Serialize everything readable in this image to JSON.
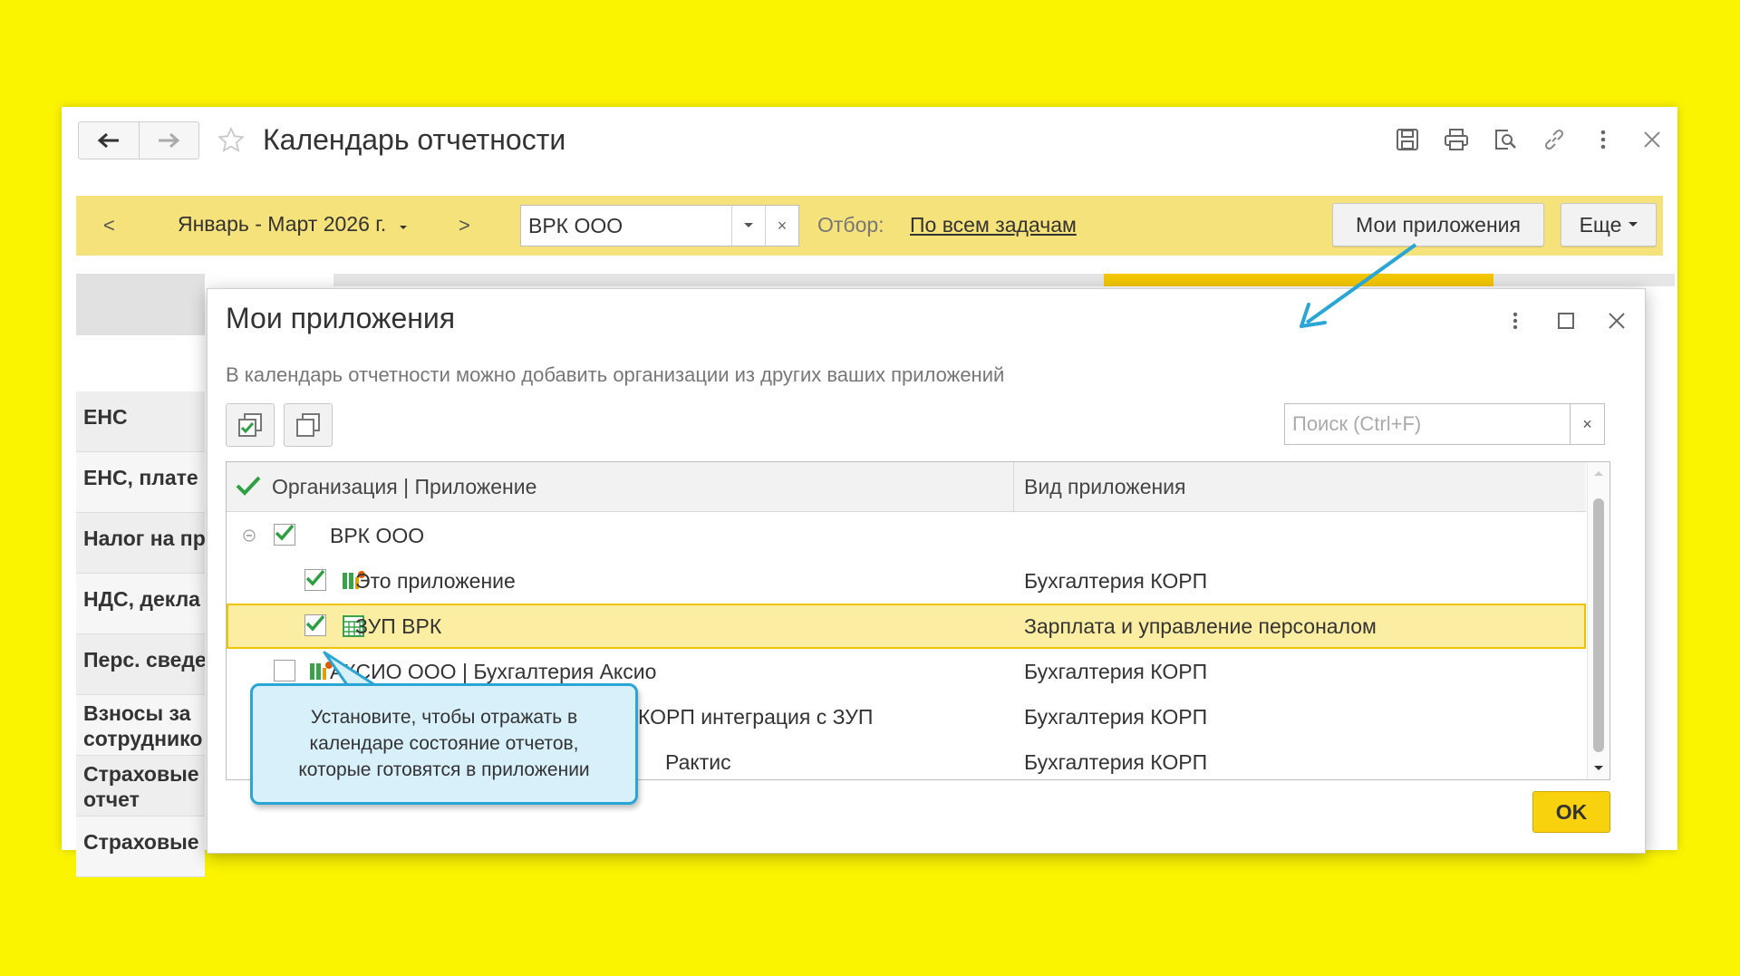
{
  "window": {
    "title": "Календарь отчетности"
  },
  "filter": {
    "prev": "<",
    "period": "Январь - Март 2026 г.",
    "next": ">",
    "organization": "ВРК ООО",
    "clear": "×",
    "otbor_label": "Отбор:",
    "otbor_value": "По всем задачам",
    "my_apps_label": "Мои приложения",
    "more_label": "Еще"
  },
  "background_rows": [
    "ЕНС",
    "ЕНС, плате",
    "Налог на пр",
    "НДС, декла",
    "Перс. сведе",
    "Взносы за сотруднико",
    "Страховые отчет",
    "Страховые"
  ],
  "dialog": {
    "title": "Мои приложения",
    "hint": "В календарь отчетности можно добавить организации из других ваших приложений",
    "search_placeholder": "Поиск (Ctrl+F)",
    "search_clear": "×",
    "ok_label": "OK",
    "columns": {
      "org": "Организация | Приложение",
      "type": "Вид приложения"
    },
    "rows": [
      {
        "name": "ВРК ООО",
        "type": "",
        "checked": true,
        "level": 0,
        "group": true,
        "icon": ""
      },
      {
        "name": "Это приложение",
        "type": "Бухгалтерия КОРП",
        "checked": true,
        "level": 1,
        "icon": "accounting-app-icon"
      },
      {
        "name": "ЗУП ВРК",
        "type": "Зарплата и управление персоналом",
        "checked": true,
        "level": 1,
        "icon": "payroll-app-icon",
        "selected": true
      },
      {
        "name": "АКСИО ООО | Бухгалтерия Аксио",
        "type": "Бухгалтерия КОРП",
        "checked": false,
        "level": 0,
        "icon": "accounting-app-icon"
      },
      {
        "name": "КОРП интеграция с ЗУП",
        "type": "Бухгалтерия КОРП",
        "checked": false,
        "level": 0,
        "icon": "accounting-app-icon"
      },
      {
        "name": "Рактис",
        "type": "Бухгалтерия КОРП",
        "checked": false,
        "level": 0,
        "icon": "accounting-app-icon"
      }
    ]
  },
  "callout": {
    "line1": "Установите, чтобы отражать в",
    "line2": "календаре состояние отчетов,",
    "line3": "которые готовятся в приложении"
  },
  "colors": {
    "background": "#fbf400",
    "accent_yellow": "#f8d10f",
    "selection": "#fbeda2",
    "check_green": "#2ea043",
    "callout_border": "#29a6d6",
    "arrow_blue": "#29a6d6"
  }
}
